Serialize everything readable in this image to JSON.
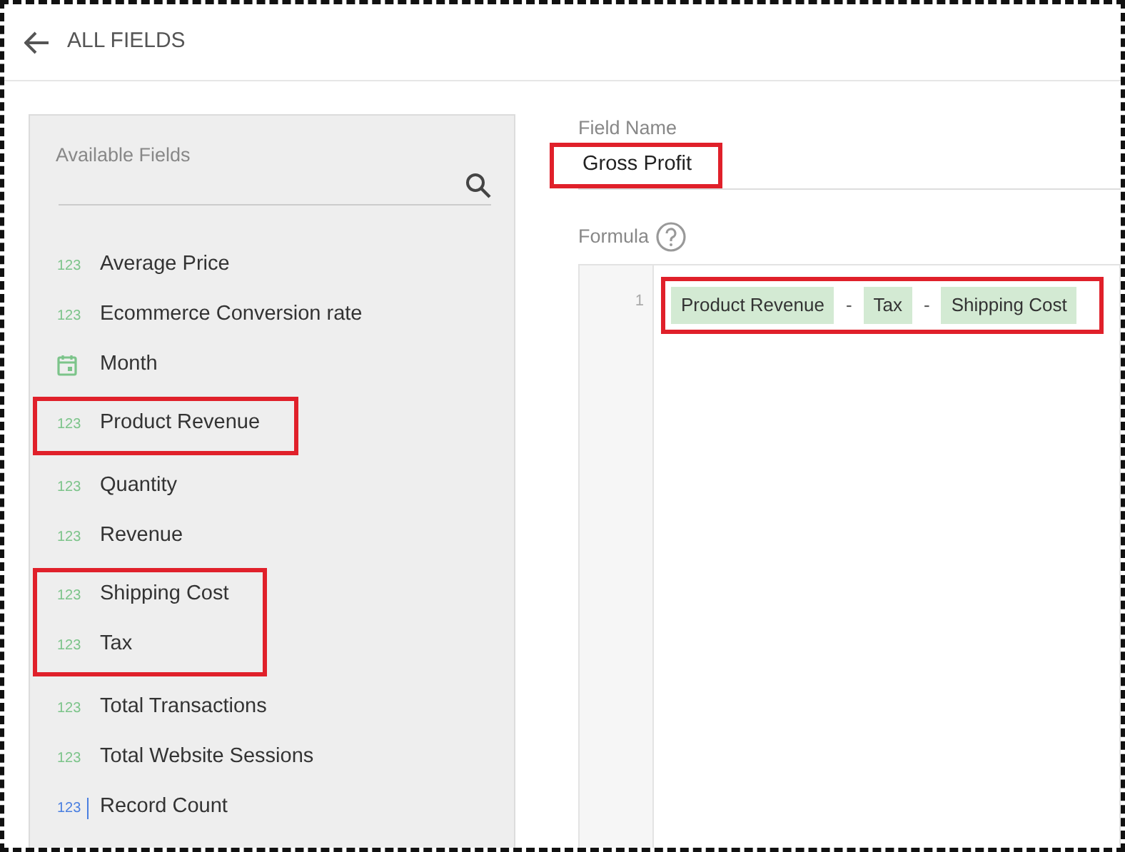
{
  "header": {
    "title": "ALL FIELDS"
  },
  "available_fields": {
    "title": "Available Fields",
    "groups": [
      {
        "highlighted": false,
        "items": [
          {
            "kind": "number",
            "type_label": "123",
            "label": "Average Price"
          },
          {
            "kind": "number",
            "type_label": "123",
            "label": "Ecommerce Conversion rate"
          },
          {
            "kind": "date",
            "label": "Month"
          }
        ]
      },
      {
        "highlighted": true,
        "items": [
          {
            "kind": "number",
            "type_label": "123",
            "label": "Product Revenue"
          }
        ]
      },
      {
        "highlighted": false,
        "items": [
          {
            "kind": "number",
            "type_label": "123",
            "label": "Quantity"
          },
          {
            "kind": "number",
            "type_label": "123",
            "label": "Revenue"
          }
        ]
      },
      {
        "highlighted": true,
        "items": [
          {
            "kind": "number",
            "type_label": "123",
            "label": "Shipping Cost"
          },
          {
            "kind": "number",
            "type_label": "123",
            "label": "Tax"
          }
        ]
      },
      {
        "highlighted": false,
        "items": [
          {
            "kind": "number",
            "type_label": "123",
            "label": "Total Transactions"
          },
          {
            "kind": "number",
            "type_label": "123",
            "label": "Total Website Sessions"
          },
          {
            "kind": "count",
            "type_label": "123",
            "label": "Record Count"
          }
        ]
      }
    ]
  },
  "field_name": {
    "label": "Field Name",
    "value": "Gross Profit",
    "highlighted": true
  },
  "formula": {
    "label": "Formula",
    "line_number": "1",
    "highlighted": true,
    "tokens": [
      {
        "kind": "field",
        "text": "Product Revenue"
      },
      {
        "kind": "operator",
        "text": "-"
      },
      {
        "kind": "field",
        "text": "Tax"
      },
      {
        "kind": "operator",
        "text": "-"
      },
      {
        "kind": "field",
        "text": "Shipping Cost"
      }
    ]
  }
}
